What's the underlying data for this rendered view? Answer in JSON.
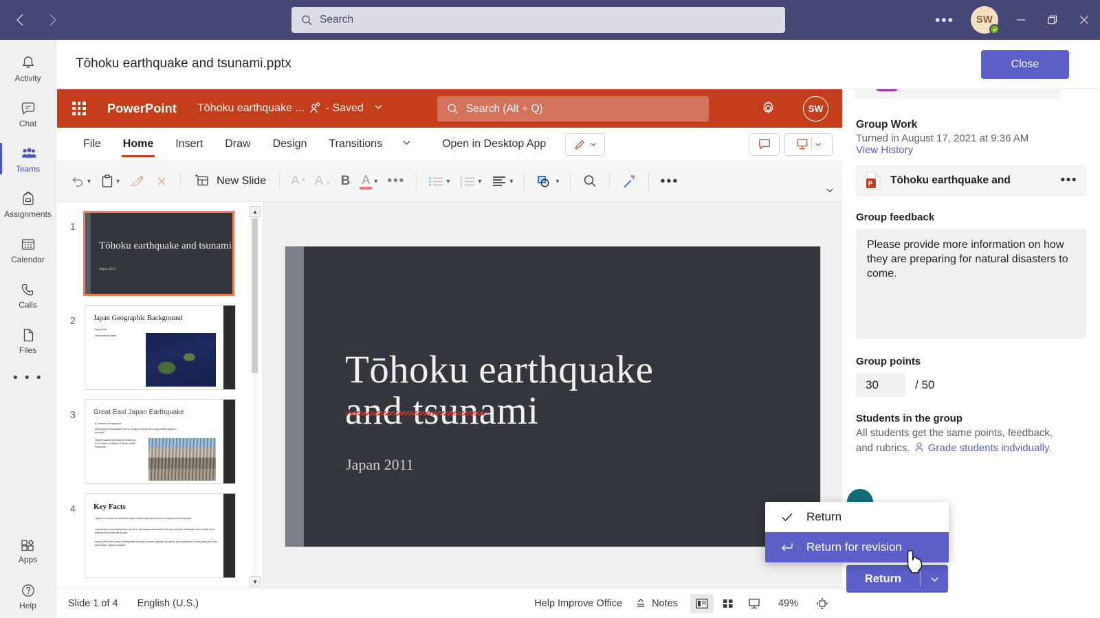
{
  "teams": {
    "search": {
      "placeholder": "Search",
      "icon": "search-icon"
    },
    "back_icon": "chevron-left-icon",
    "forward_icon": "chevron-right-icon",
    "more_label": "•••",
    "avatar_initials": "SW",
    "rail": [
      {
        "label": "Activity",
        "icon": "bell-icon",
        "active": false
      },
      {
        "label": "Chat",
        "icon": "chat-icon",
        "active": false
      },
      {
        "label": "Teams",
        "icon": "people-icon",
        "active": true
      },
      {
        "label": "Assignments",
        "icon": "backpack-icon",
        "active": false
      },
      {
        "label": "Calendar",
        "icon": "calendar-icon",
        "active": false
      },
      {
        "label": "Calls",
        "icon": "phone-icon",
        "active": false
      },
      {
        "label": "Files",
        "icon": "file-icon",
        "active": false
      }
    ],
    "rail_more": "• • •",
    "rail_bottom": [
      {
        "label": "Apps",
        "icon": "apps-icon"
      },
      {
        "label": "Help",
        "icon": "help-icon"
      }
    ]
  },
  "doc_header": {
    "title": "Tōhoku earthquake and tsunami.pptx",
    "close_label": "Close"
  },
  "powerpoint": {
    "app_name": "PowerPoint",
    "file_name": "Tōhoku earthquake ...",
    "saved_label": "- Saved",
    "search_placeholder": "Search (Alt + Q)",
    "avatar_initials": "SW",
    "tabs": [
      {
        "label": "File",
        "active": false
      },
      {
        "label": "Home",
        "active": true
      },
      {
        "label": "Insert",
        "active": false
      },
      {
        "label": "Draw",
        "active": false
      },
      {
        "label": "Design",
        "active": false
      },
      {
        "label": "Transitions",
        "active": false
      }
    ],
    "open_desktop_label": "Open in Desktop App",
    "ribbon": {
      "new_slide_label": "New Slide",
      "bold_label": "B",
      "font_grow_label": "A",
      "font_shrink_label": "A",
      "font_color_label": "A",
      "more_label": "•••",
      "more_label2": "•••"
    },
    "slides": [
      {
        "number": "1",
        "title": "Tōhoku earthquake and tsunami",
        "subtitle": "Japan 2011",
        "selected": true,
        "kind": "dark-title"
      },
      {
        "number": "2",
        "title": "Japan Geographic Background",
        "bullets": [
          "Ring of Fire",
          "Surrounded by water"
        ],
        "selected": false,
        "kind": "map"
      },
      {
        "number": "3",
        "title": "Great East Japan Earthquake",
        "bullets": [
          "9.0 moment of magnitude",
          "Most powerful earthquake ever to hit Japan and the 4th most powerful quake in the world",
          "Tsunami waves that reached heights up to 40 meters in Miyako in Tohoku Iwate Prefecture"
        ],
        "selected": false,
        "kind": "photo"
      },
      {
        "number": "4",
        "title": "Key Facts",
        "bullets": [
          "Japan is a country surrounded by seas of water and faces a series of dangerous earthquakes.",
          "Underseas or land earthquakes can be a very dangerous tsunami in the sea and then earthquake and a whole lot of property and homes life as land.",
          "Around 20% of the world's earthquakes and each seismic activities are said to be concentrated on this small part of the world where Japan is located."
        ],
        "selected": false,
        "kind": "text"
      }
    ],
    "current_slide": {
      "title_line1": "Tōhoku earthquake",
      "title_line2": "and tsunami",
      "subtitle": "Japan 2011"
    },
    "status_bar": {
      "slide_count": "Slide 1 of 4",
      "language": "English (U.S.)",
      "help_improve": "Help Improve Office",
      "notes_label": "Notes",
      "zoom": "49%",
      "view_normal_icon": "normal-view-icon",
      "view_sorter_icon": "slide-sorter-icon",
      "view_reading_icon": "reading-view-icon",
      "fit_icon": "fit-to-window-icon"
    }
  },
  "grading_panel": {
    "group_work_heading": "Group Work",
    "turned_in": "Turned in August 17, 2021 at 9:36 AM",
    "view_history": "View History",
    "attachment_name": "Tōhoku earthquake and",
    "attachment_more": "•••",
    "feedback_label": "Group feedback",
    "feedback_text": "Please provide more information on how they are preparing for natural disasters to come.",
    "points_label": "Group points",
    "points_value": "30",
    "points_total": "/ 50",
    "students_label": "Students in the group",
    "students_note_1": "All students get the same points, feedback,",
    "students_note_2": "and rubrics.",
    "grade_individually_link": "Grade students indvidually.",
    "return_button": "Return",
    "return_chevron_icon": "chevron-down-icon",
    "dropdown": [
      {
        "label": "Return",
        "icon": "check-icon",
        "selected": false
      },
      {
        "label": "Return for revision",
        "icon": "return-arrow-icon",
        "selected": true
      }
    ]
  },
  "colors": {
    "teams_purple": "#464775",
    "teams_accent": "#5b5fc7",
    "powerpoint_red": "#c43e1c",
    "slide_selected": "#ed7d56",
    "presence_green": "#6bb700"
  }
}
